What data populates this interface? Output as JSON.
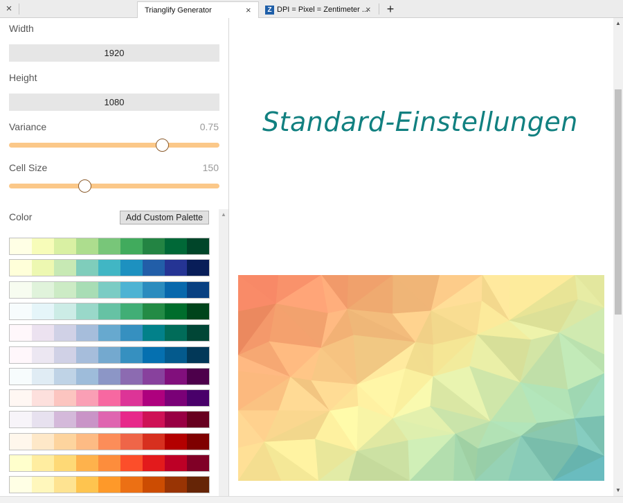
{
  "tabs": [
    {
      "title": "Trianglify Generator",
      "active": true
    },
    {
      "title": "DPI = Pixel = Zentimeter ...",
      "active": false,
      "favicon": "Z"
    }
  ],
  "icons": {
    "close": "×",
    "new_tab": "+",
    "scroll_up": "▲",
    "scroll_down": "▼"
  },
  "controls": {
    "width_label": "Width",
    "width_value": "1920",
    "height_label": "Height",
    "height_value": "1080",
    "variance_label": "Variance",
    "variance_value": "0.75",
    "variance_fraction": 0.73,
    "cellsize_label": "Cell Size",
    "cellsize_value": "150",
    "cellsize_fraction": 0.36,
    "color_label": "Color",
    "add_palette_label": "Add Custom Palette",
    "slider_color": "#fbc889"
  },
  "palettes": [
    [
      "#ffffe5",
      "#f7fcb9",
      "#d9f0a3",
      "#addd8e",
      "#78c679",
      "#41ab5d",
      "#238443",
      "#006837",
      "#004529"
    ],
    [
      "#ffffd9",
      "#edf8b1",
      "#c7e9b4",
      "#7fcdbb",
      "#41b6c4",
      "#1d91c0",
      "#225ea8",
      "#253494",
      "#081d58"
    ],
    [
      "#f7fcf0",
      "#e0f3db",
      "#ccebc5",
      "#a8ddb5",
      "#7bccc4",
      "#4eb3d3",
      "#2b8cbe",
      "#0868ac",
      "#084081"
    ],
    [
      "#f7fcfd",
      "#e5f5f9",
      "#ccece6",
      "#99d8c9",
      "#66c2a4",
      "#41ae76",
      "#238b45",
      "#006d2c",
      "#00441b"
    ],
    [
      "#fff7fb",
      "#ece2f0",
      "#d0d1e6",
      "#a6bddb",
      "#67a9cf",
      "#3690c0",
      "#02818a",
      "#016c59",
      "#014636"
    ],
    [
      "#fff7fb",
      "#ece7f2",
      "#d0d1e6",
      "#a6bddb",
      "#74a9cf",
      "#3690c0",
      "#0570b0",
      "#045a8d",
      "#023858"
    ],
    [
      "#f7fcfd",
      "#e0ecf4",
      "#bfd3e6",
      "#9ebcda",
      "#8c96c6",
      "#8c6bb1",
      "#88419d",
      "#810f7c",
      "#4d004b"
    ],
    [
      "#fff7f3",
      "#fde0dd",
      "#fcc5c0",
      "#fa9fb5",
      "#f768a1",
      "#dd3497",
      "#ae017e",
      "#7a0177",
      "#49006a"
    ],
    [
      "#f7f4f9",
      "#e7e1ef",
      "#d4b9da",
      "#c994c7",
      "#df65b0",
      "#e7298a",
      "#ce1256",
      "#980043",
      "#67001f"
    ],
    [
      "#fff7ec",
      "#fee8c8",
      "#fdd49e",
      "#fdbb84",
      "#fc8d59",
      "#ef6548",
      "#d7301f",
      "#b30000",
      "#7f0000"
    ],
    [
      "#ffffcc",
      "#ffeda0",
      "#fed976",
      "#feb24c",
      "#fd8d3c",
      "#fc4e2a",
      "#e31a1c",
      "#bd0026",
      "#800026"
    ],
    [
      "#ffffe5",
      "#fff7bc",
      "#fee391",
      "#fec44f",
      "#fe9929",
      "#ec7014",
      "#cc4c02",
      "#993404",
      "#662506"
    ]
  ],
  "preview": {
    "heading": "Standard-Einstellungen",
    "heading_color": "#118080",
    "gradient_colors": [
      "#f1755a",
      "#fbb37a",
      "#fdf2a0",
      "#a8dbb0",
      "#4fa8b5"
    ]
  }
}
